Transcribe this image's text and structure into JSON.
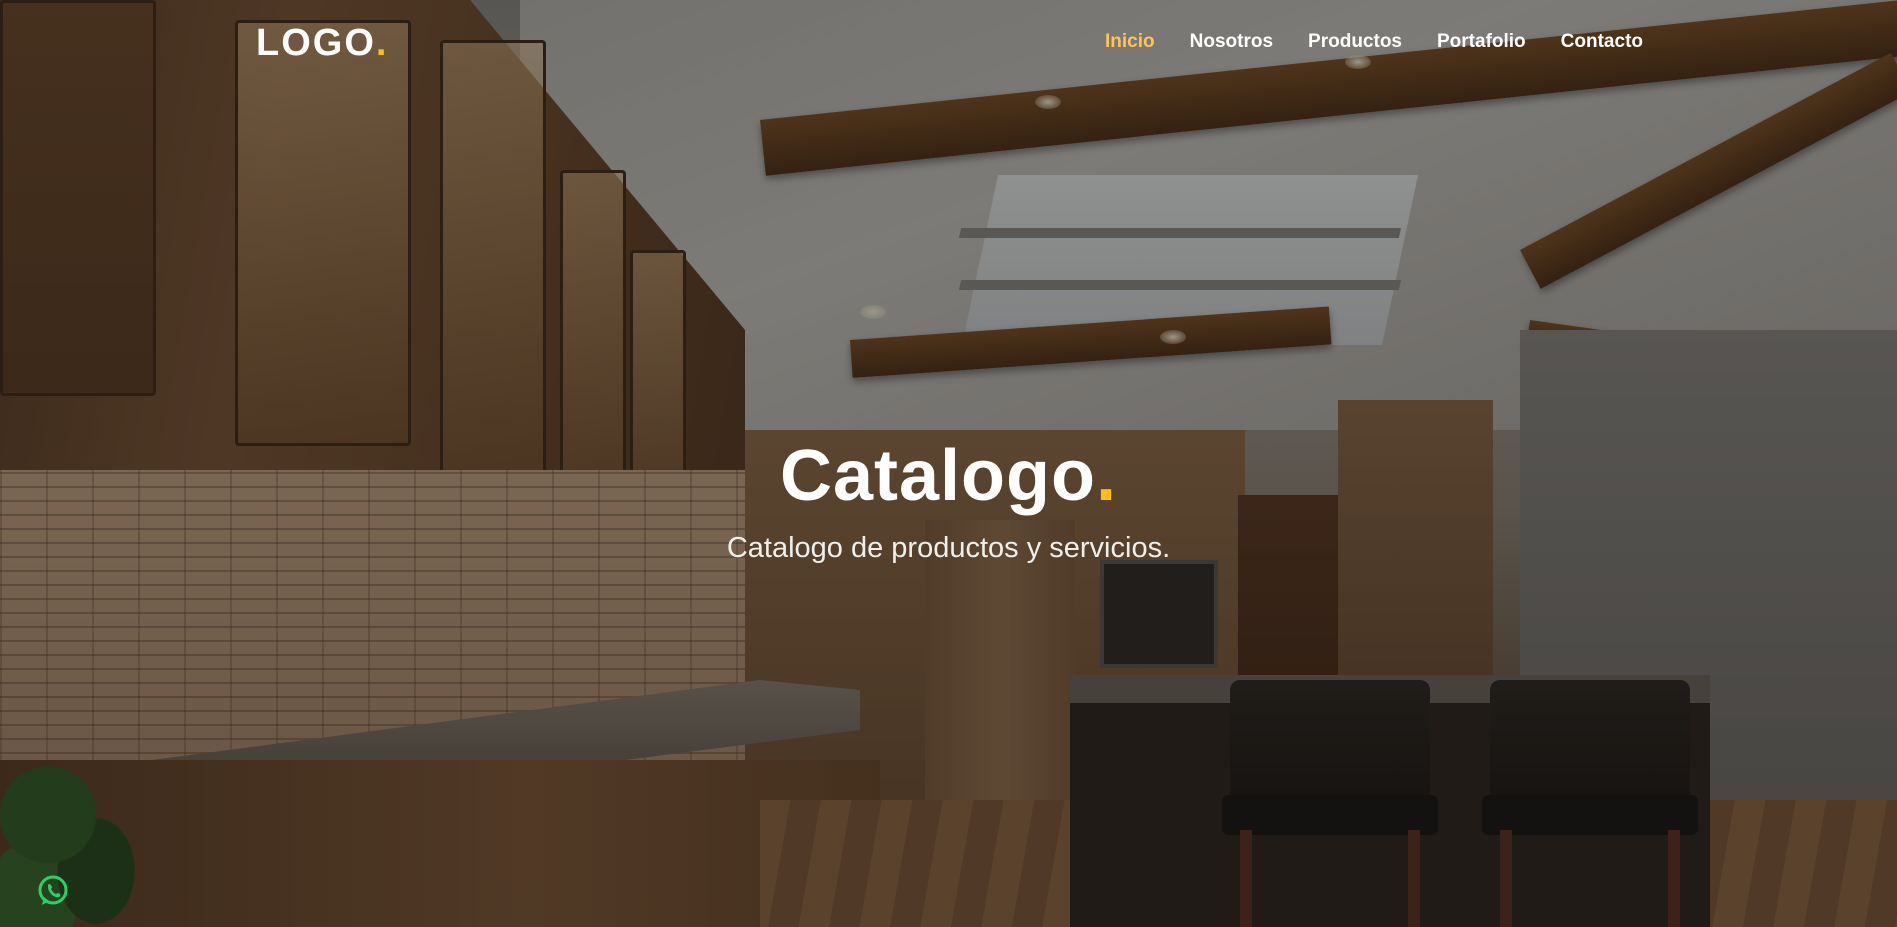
{
  "header": {
    "logo_text": "LOGO",
    "logo_dot": "."
  },
  "nav": {
    "items": [
      {
        "label": "Inicio",
        "active": true
      },
      {
        "label": "Nosotros",
        "active": false
      },
      {
        "label": "Productos",
        "active": false
      },
      {
        "label": "Portafolio",
        "active": false
      },
      {
        "label": "Contacto",
        "active": false
      }
    ]
  },
  "hero": {
    "title": "Catalogo",
    "title_dot": ".",
    "subtitle": "Catalogo de productos y servicios."
  },
  "colors": {
    "accent": "#ffc107",
    "nav_active": "#ffc451",
    "text": "#ffffff"
  },
  "icons": {
    "floating": "whatsapp-icon"
  }
}
